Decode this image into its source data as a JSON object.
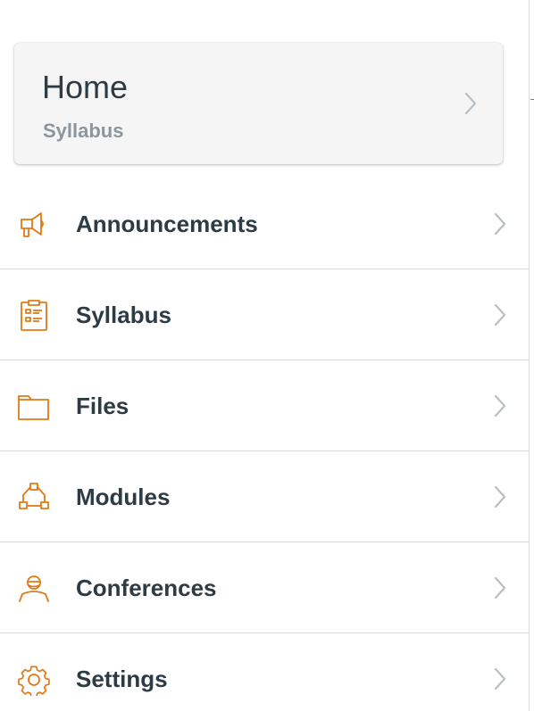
{
  "home": {
    "title": "Home",
    "subtitle": "Syllabus"
  },
  "menu": {
    "items": [
      {
        "label": "Announcements",
        "icon": "megaphone-icon"
      },
      {
        "label": "Syllabus",
        "icon": "clipboard-icon"
      },
      {
        "label": "Files",
        "icon": "folder-icon"
      },
      {
        "label": "Modules",
        "icon": "modules-icon"
      },
      {
        "label": "Conferences",
        "icon": "conferences-icon"
      },
      {
        "label": "Settings",
        "icon": "gear-icon"
      }
    ]
  },
  "colors": {
    "accent": "#e07a16",
    "text": "#2d3b45",
    "muted": "#8b969e",
    "chevron": "#b8bfc4"
  }
}
